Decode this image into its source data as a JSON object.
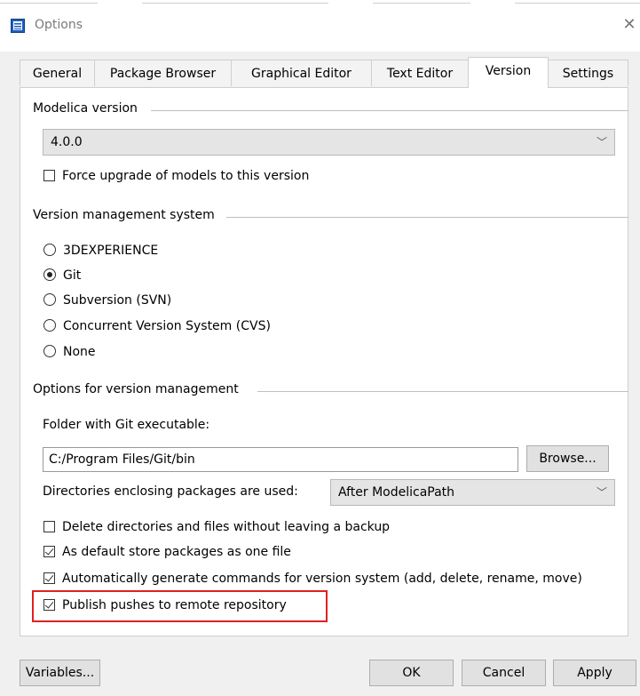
{
  "window": {
    "title": "Options"
  },
  "tabs": [
    {
      "label": "General"
    },
    {
      "label": "Package Browser"
    },
    {
      "label": "Graphical Editor"
    },
    {
      "label": "Text Editor"
    },
    {
      "label": "Version"
    },
    {
      "label": "Settings"
    }
  ],
  "active_tab": "Version",
  "modelica_version": {
    "title": "Modelica version",
    "selected": "4.0.0",
    "force_upgrade": {
      "label": "Force upgrade of models to this version",
      "checked": false
    }
  },
  "vms": {
    "title": "Version management system",
    "options": [
      {
        "label": "3DEXPERIENCE",
        "checked": false
      },
      {
        "label": "Git",
        "checked": true
      },
      {
        "label": "Subversion (SVN)",
        "checked": false
      },
      {
        "label": "Concurrent Version System (CVS)",
        "checked": false
      },
      {
        "label": "None",
        "checked": false
      }
    ]
  },
  "options_vm": {
    "title": "Options for version management",
    "folder_label": "Folder with Git executable:",
    "folder_value": "C:/Program Files/Git/bin",
    "browse": "Browse...",
    "dirs_label": "Directories enclosing packages are used:",
    "dirs_value": "After ModelicaPath",
    "checks": [
      {
        "label": "Delete directories and files without leaving a backup",
        "checked": false
      },
      {
        "label": "As default store packages as one file",
        "checked": true
      },
      {
        "label": "Automatically generate commands for version system (add, delete, rename, move)",
        "checked": true
      },
      {
        "label": "Publish pushes to remote repository",
        "checked": true
      }
    ]
  },
  "footer": {
    "variables": "Variables...",
    "ok": "OK",
    "cancel": "Cancel",
    "apply": "Apply"
  },
  "colors": {
    "highlight": "#e02020",
    "dialog_bg": "#f0f0f0"
  },
  "icons": {
    "app": "options-window-icon",
    "close": "close-icon",
    "dropdown": "chevron-down-icon"
  }
}
